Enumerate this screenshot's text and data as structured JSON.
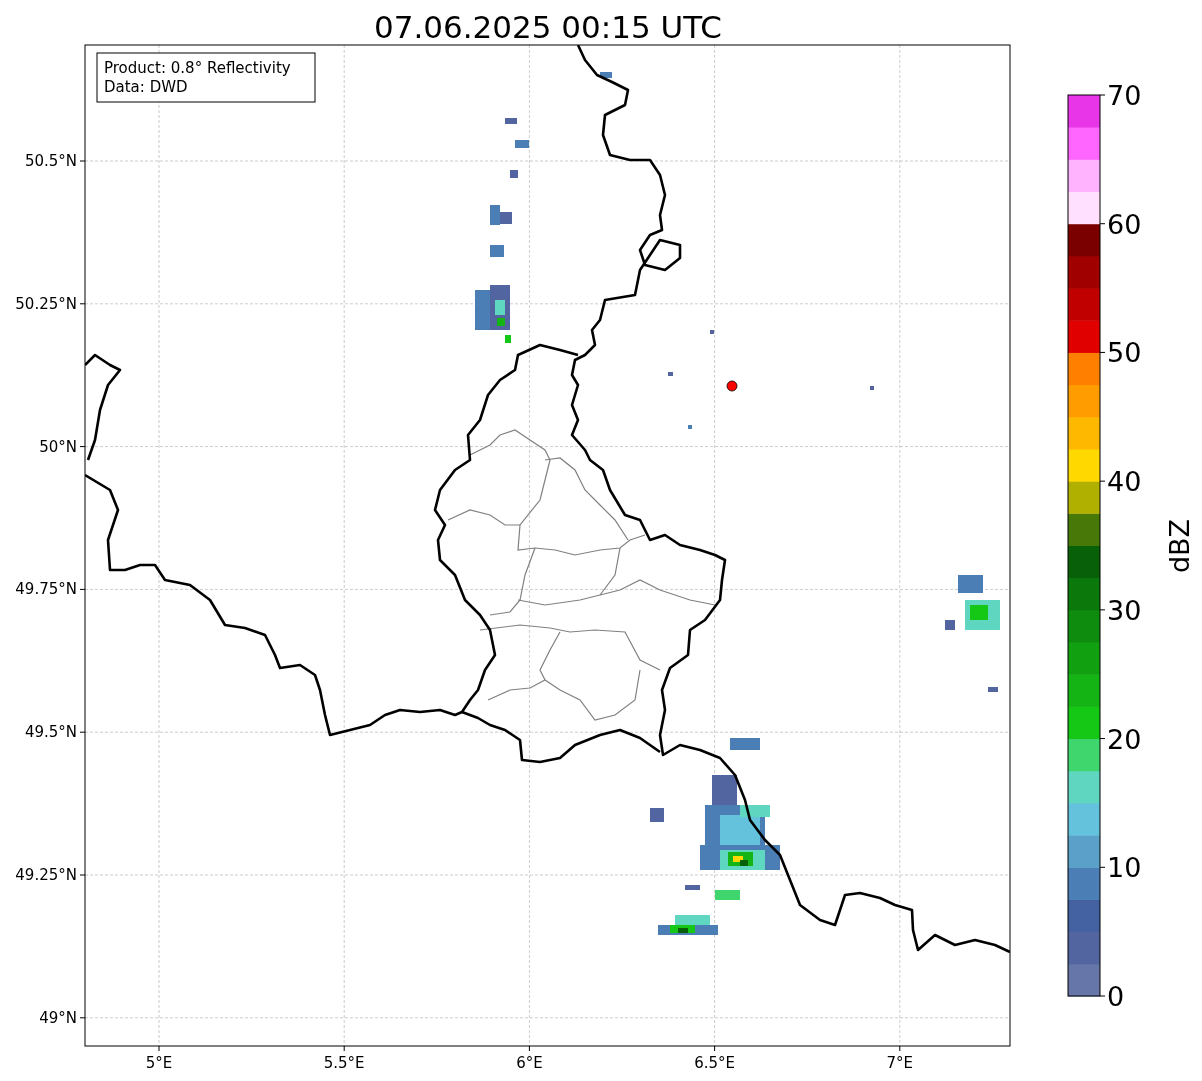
{
  "title": "07.06.2025 00:15 UTC",
  "info_box": [
    "Product: 0.8° Reflectivity",
    "Data: DWD"
  ],
  "lat_ticks": [
    "50.5°N",
    "50.25°N",
    "50°N",
    "49.75°N",
    "49.5°N",
    "49.25°N",
    "49°N"
  ],
  "lon_ticks": [
    "5°E",
    "5.5°E",
    "6°E",
    "6.5°E",
    "7°E"
  ],
  "colorbar": {
    "label": "dBZ",
    "ticks": [
      "70",
      "60",
      "50",
      "40",
      "30",
      "20",
      "10",
      "0"
    ],
    "bands": [
      {
        "color": "#6676a8"
      },
      {
        "color": "#5365a0"
      },
      {
        "color": "#4461a2"
      },
      {
        "color": "#4b7eb4"
      },
      {
        "color": "#5ba0c8"
      },
      {
        "color": "#65c2dc"
      },
      {
        "color": "#5fd6c0"
      },
      {
        "color": "#3fd66e"
      },
      {
        "color": "#15c815"
      },
      {
        "color": "#13b413"
      },
      {
        "color": "#10a010"
      },
      {
        "color": "#0d8c0d"
      },
      {
        "color": "#0b780b"
      },
      {
        "color": "#086008"
      },
      {
        "color": "#487808"
      },
      {
        "color": "#b0b000"
      },
      {
        "color": "#ffd800"
      },
      {
        "color": "#ffb800"
      },
      {
        "color": "#ff9c00"
      },
      {
        "color": "#ff8000"
      },
      {
        "color": "#e00000"
      },
      {
        "color": "#c00000"
      },
      {
        "color": "#a00000"
      },
      {
        "color": "#7a0000"
      },
      {
        "color": "#ffe0ff"
      },
      {
        "color": "#ffb3ff"
      },
      {
        "color": "#ff66ff"
      },
      {
        "color": "#e835e8"
      }
    ]
  }
}
